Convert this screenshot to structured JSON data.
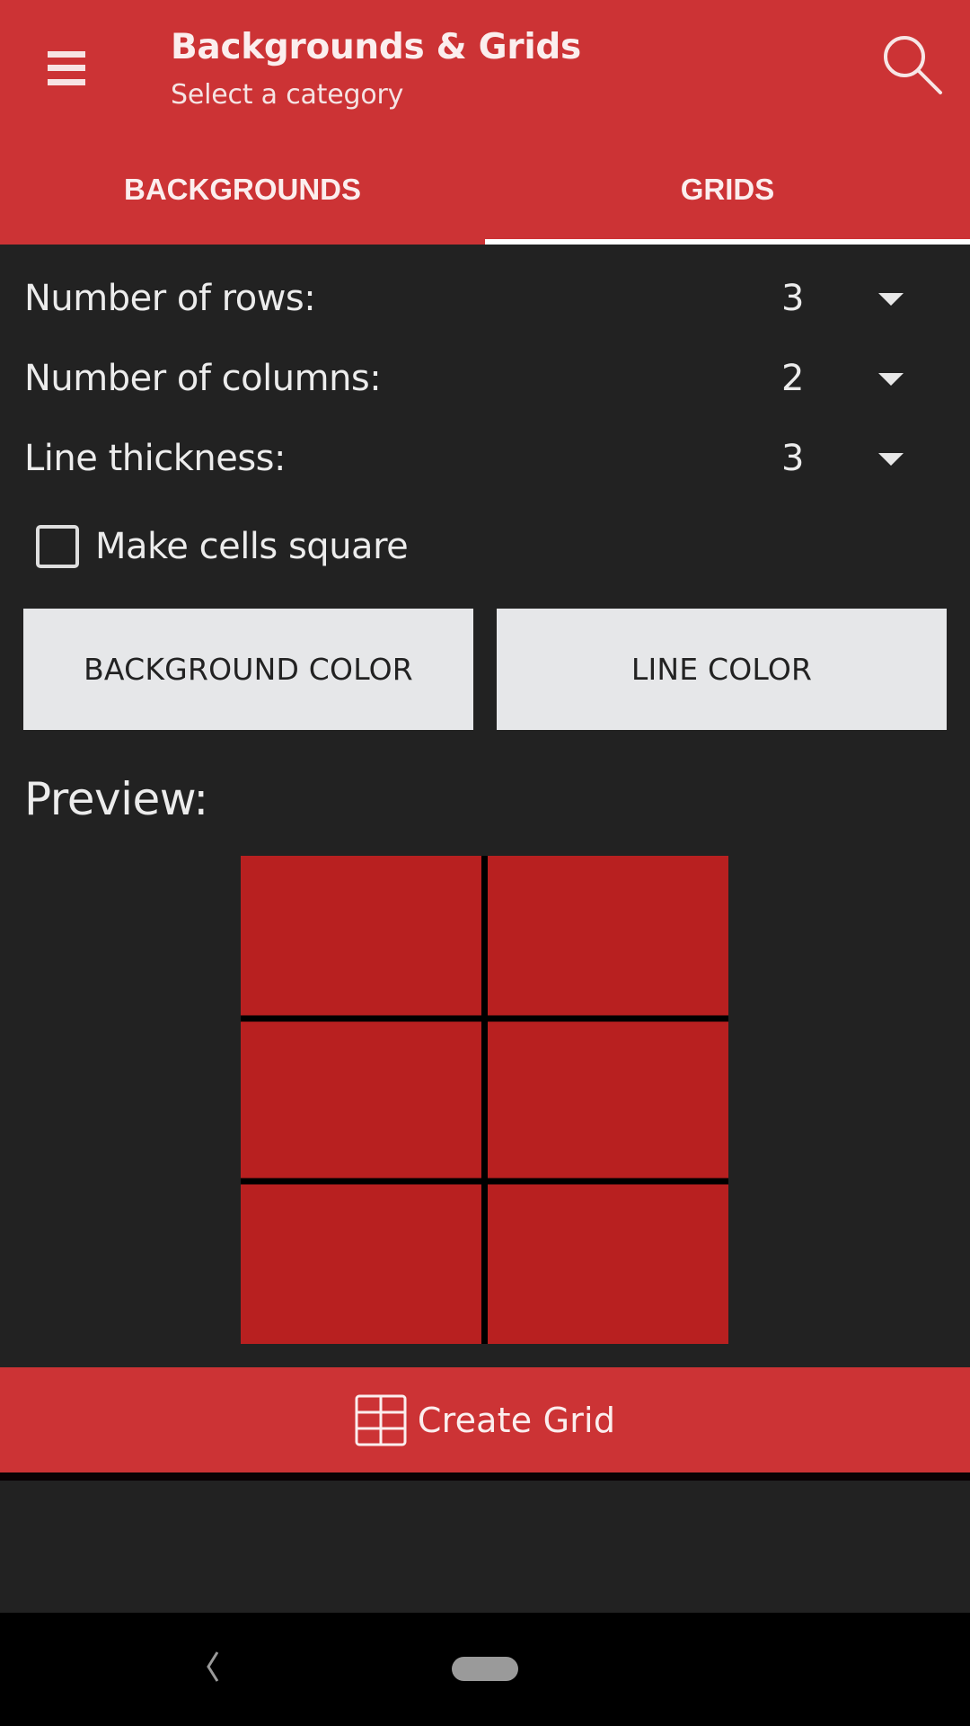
{
  "appbar": {
    "title": "Backgrounds & Grids",
    "subtitle": "Select a category",
    "menu_icon": "hamburger-menu-icon",
    "search_icon": "search-icon",
    "color": "#cc3335"
  },
  "tabs": [
    {
      "label": "BACKGROUNDS",
      "active": false
    },
    {
      "label": "GRIDS",
      "active": true
    }
  ],
  "settings": {
    "rows": {
      "label": "Number of rows:",
      "value": "3"
    },
    "columns": {
      "label": "Number of columns:",
      "value": "2"
    },
    "thickness": {
      "label": "Line thickness:",
      "value": "3"
    }
  },
  "square_cells": {
    "label": "Make cells square",
    "checked": false
  },
  "buttons": {
    "background_color": "BACKGROUND COLOR",
    "line_color": "LINE COLOR"
  },
  "preview": {
    "title": "Preview:",
    "rows": 3,
    "columns": 2,
    "background_color": "#b82020",
    "line_color": "#000000"
  },
  "create_button": {
    "label": "Create Grid",
    "icon": "grid-icon"
  },
  "navbar": {
    "back_icon": "back-icon",
    "home_icon": "home-pill-icon"
  }
}
